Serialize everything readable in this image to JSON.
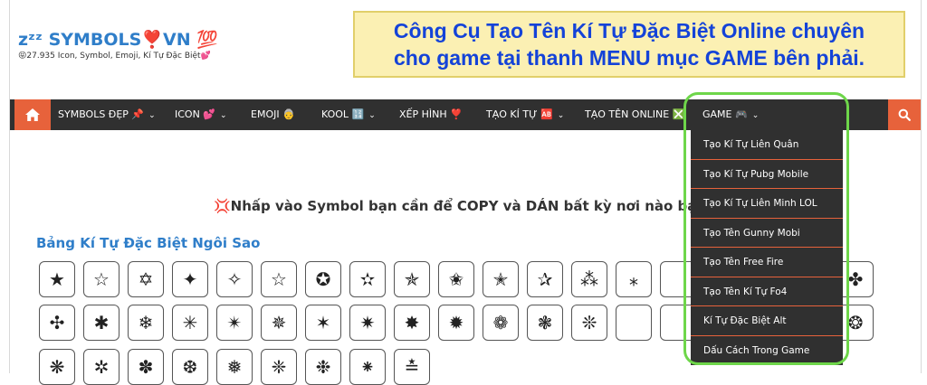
{
  "logo": {
    "title": "SYMBOLS❣️VN 💯",
    "zz": "zᶻᶻ",
    "subtitle": "😝27.935 Icon, Symbol, Emoji, Kí Tự Đặc Biệt💕"
  },
  "banner": {
    "line1": "Công Cụ Tạo Tên Kí Tự Đặc Biệt Online chuyên",
    "line2": "cho game tại thanh MENU mục GAME bên phải."
  },
  "nav": {
    "home_icon": "home-icon",
    "search_icon": "search-icon",
    "items": [
      {
        "label": "SYMBOLS ĐẸP 📌"
      },
      {
        "label": "ICON 💕"
      },
      {
        "label": "EMOJI 👵"
      },
      {
        "label": "KOOL 🔢"
      },
      {
        "label": "XẾP HÌNH ❣️"
      },
      {
        "label": "TẠO KÍ TỰ 🆎"
      },
      {
        "label": "TẠO TÊN ONLINE ❎"
      },
      {
        "label": "GAME 🎮"
      }
    ]
  },
  "dropdown": {
    "items": [
      "Tạo Kí Tự Liên Quân",
      "Tạo Kí Tự Pubg Mobile",
      "Tạo Kí Tự Liên Minh LOL",
      "Tạo Tên Gunny Mobi",
      "Tạo Tên Free Fire",
      "Tạo Tên Kí Tự Fo4",
      "Kí Tự Đặc Biệt Alt",
      "Dấu Cách Trong Game"
    ]
  },
  "instruction": "💢Nhấp vào Symbol bạn cần để COPY và DÁN bất kỳ nơi nào bạn m",
  "section_title": "Bảng Kí Tự Đặc Biệt Ngôi Sao",
  "symbols": {
    "row1": [
      "★",
      "☆",
      "✡",
      "✦",
      "✧",
      "☆",
      "✪",
      "✫",
      "✯",
      "✬",
      "✭",
      "✰",
      "⁂",
      "⁎",
      "",
      "",
      "",
      "",
      "✤"
    ],
    "row2": [
      "✣",
      "✱",
      "❄",
      "✳",
      "✴",
      "✵",
      "✶",
      "✷",
      "✸",
      "✹",
      "❁",
      "❃",
      "❊",
      "",
      "",
      "",
      "",
      "",
      "❂"
    ],
    "row3": [
      "❋",
      "✲",
      "✽",
      "❆",
      "❅",
      "❈",
      "❉",
      "⁕",
      "≛"
    ]
  }
}
